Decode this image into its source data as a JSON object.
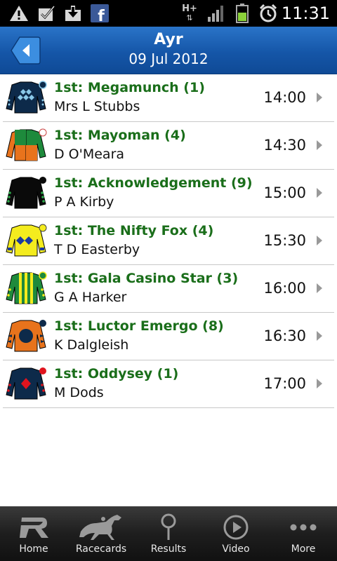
{
  "status_bar": {
    "time": "11:31",
    "icons": [
      "warning-icon",
      "checkbox-icon",
      "download-icon",
      "facebook-icon",
      "hplus-network-icon",
      "signal-icon",
      "battery-icon",
      "alarm-icon"
    ],
    "network_label": "H+",
    "facebook_label": "f"
  },
  "header": {
    "title": "Ayr",
    "date": "09 Jul 2012"
  },
  "races": [
    {
      "winner": "1st: Megamunch (1)",
      "trainer": "Mrs L Stubbs",
      "time": "14:00"
    },
    {
      "winner": "1st: Mayoman (4)",
      "trainer": "D O'Meara",
      "time": "14:30"
    },
    {
      "winner": "1st: Acknowledgement (9)",
      "trainer": "P A Kirby",
      "time": "15:00"
    },
    {
      "winner": "1st: The Nifty Fox (4)",
      "trainer": "T D Easterby",
      "time": "15:30"
    },
    {
      "winner": "1st: Gala Casino Star (3)",
      "trainer": "G A Harker",
      "time": "16:00"
    },
    {
      "winner": "1st: Luctor Emergo (8)",
      "trainer": "K Dalgleish",
      "time": "16:30"
    },
    {
      "winner": "1st: Oddysey (1)",
      "trainer": "M Dods",
      "time": "17:00"
    }
  ],
  "nav": [
    {
      "label": "Home",
      "icon": "home-r-logo-icon"
    },
    {
      "label": "Racecards",
      "icon": "racehorse-icon"
    },
    {
      "label": "Results",
      "icon": "results-pin-icon"
    },
    {
      "label": "Video",
      "icon": "play-icon"
    },
    {
      "label": "More",
      "icon": "more-dots-icon"
    }
  ],
  "colors": {
    "header_blue": "#1556a8",
    "winner_green": "#1a6e1a",
    "nav_bg": "#1e1e1e"
  }
}
